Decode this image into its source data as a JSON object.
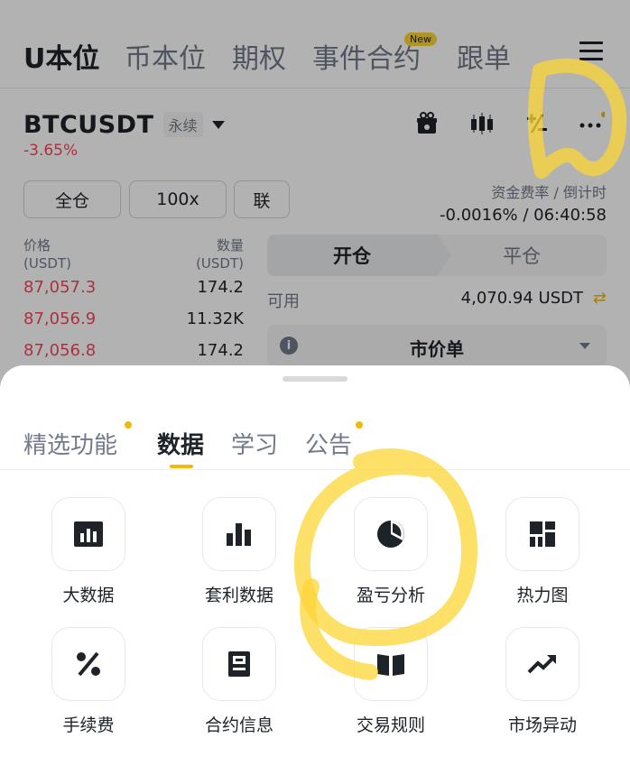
{
  "top_nav": {
    "tabs": [
      "U本位",
      "币本位",
      "期权",
      "事件合约",
      "跟单"
    ],
    "new_badge": "New",
    "menu_icon": "hamburger-menu-icon"
  },
  "pair": {
    "symbol": "BTCUSDT",
    "type_tag": "永续",
    "change": "-3.65%"
  },
  "toolbar_icons": [
    "gift-icon",
    "candlestick-icon",
    "plus-minus-icon",
    "more-dots-icon"
  ],
  "leverage": {
    "margin_mode": "全仓",
    "leverage": "100x",
    "position_mode": "联"
  },
  "funding": {
    "label": "资金费率 / 倒计时",
    "value": "-0.0016% / 06:40:58"
  },
  "orderbook": {
    "price_header": "价格",
    "price_unit": "(USDT)",
    "qty_header": "数量",
    "qty_unit": "(USDT)",
    "rows": [
      {
        "price": "87,057.3",
        "qty": "174.2"
      },
      {
        "price": "87,056.9",
        "qty": "11.32K"
      },
      {
        "price": "87,056.8",
        "qty": "174.2"
      }
    ]
  },
  "trade_panel": {
    "open_label": "开仓",
    "close_label": "平仓",
    "available_label": "可用",
    "available_value": "4,070.94 USDT",
    "order_type": "市价单"
  },
  "sheet": {
    "tabs": [
      "精选功能",
      "数据",
      "学习",
      "公告"
    ],
    "active_tab": "数据",
    "features": [
      {
        "label": "大数据",
        "icon": "bar-chart-box-icon"
      },
      {
        "label": "套利数据",
        "icon": "bar-chart-icon"
      },
      {
        "label": "盈亏分析",
        "icon": "pie-chart-icon"
      },
      {
        "label": "热力图",
        "icon": "heatmap-grid-icon"
      },
      {
        "label": "手续费",
        "icon": "percent-icon"
      },
      {
        "label": "合约信息",
        "icon": "contract-document-icon"
      },
      {
        "label": "交易规则",
        "icon": "open-book-icon"
      },
      {
        "label": "市场异动",
        "icon": "trending-up-icon"
      }
    ]
  },
  "colors": {
    "accent": "#f0b90b",
    "sell": "#f6465d",
    "text": "#1e2329",
    "muted": "#707a8a",
    "highlight_marker": "#fcd535"
  }
}
